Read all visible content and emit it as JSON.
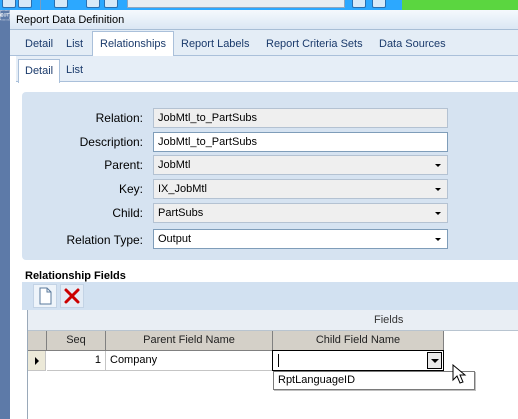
{
  "panel": {
    "title": "Report Data Definition"
  },
  "main_tabs": [
    {
      "label": "Detail"
    },
    {
      "label": "List"
    },
    {
      "label": "Relationships"
    },
    {
      "label": "Report Labels"
    },
    {
      "label": "Report Criteria Sets"
    },
    {
      "label": "Data Sources"
    }
  ],
  "sub_tabs": [
    {
      "label": "Detail"
    },
    {
      "label": "List"
    }
  ],
  "form": {
    "relation": {
      "label": "Relation:",
      "value": "JobMtl_to_PartSubs"
    },
    "description": {
      "label": "Description:",
      "value": "JobMtl_to_PartSubs"
    },
    "parent": {
      "label": "Parent:",
      "value": "JobMtl"
    },
    "key": {
      "label": "Key:",
      "value": "IX_JobMtl"
    },
    "child": {
      "label": "Child:",
      "value": "PartSubs"
    },
    "relation_type": {
      "label": "Relation Type:",
      "value": "Output"
    }
  },
  "relationship_fields": {
    "title": "Relationship Fields",
    "group_header": "Fields",
    "columns": [
      "Seq",
      "Parent Field Name",
      "Child Field Name"
    ],
    "rows": [
      {
        "seq": "1",
        "parent_field": "Company",
        "child_field": ""
      }
    ],
    "dropdown_options": [
      "RptLanguageID"
    ]
  },
  "icons": {
    "new": "new-document-icon",
    "delete": "delete-x-icon",
    "row_indicator": "row-pointer-icon"
  },
  "colors": {
    "form_background": "#d6e3f1",
    "delete_red": "#cc0000",
    "toolbar_green": "#5bd640"
  }
}
